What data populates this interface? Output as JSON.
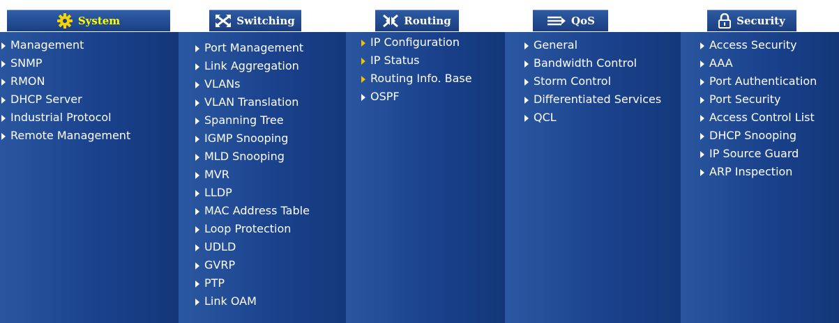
{
  "colors": {
    "tab_text": "#ffffff",
    "active_tab_text": "#ffff00",
    "item_text": "#ffffff",
    "routing_arrow": "#f5c000"
  },
  "tabs": [
    {
      "key": "system",
      "label": "System",
      "icon": "gear-icon",
      "active": true
    },
    {
      "key": "switching",
      "label": "Switching",
      "icon": "crossed-arrows-icon",
      "active": false
    },
    {
      "key": "routing",
      "label": "Routing",
      "icon": "converging-arrows-icon",
      "active": false
    },
    {
      "key": "qos",
      "label": "QoS",
      "icon": "lanes-arrow-icon",
      "active": false
    },
    {
      "key": "security",
      "label": "Security",
      "icon": "padlock-icon",
      "active": false
    }
  ],
  "columns": {
    "system": [
      "Management",
      "SNMP",
      "RMON",
      "DHCP Server",
      "Industrial Protocol",
      "Remote Management"
    ],
    "switching": [
      "Port Management",
      "Link Aggregation",
      "VLANs",
      "VLAN Translation",
      "Spanning Tree",
      "IGMP Snooping",
      "MLD Snooping",
      "MVR",
      "LLDP",
      "MAC Address Table",
      "Loop Protection",
      "UDLD",
      "GVRP",
      "PTP",
      "Link OAM"
    ],
    "routing": [
      "IP Configuration",
      "IP Status",
      "Routing Info. Base",
      "OSPF"
    ],
    "qos": [
      "General",
      "Bandwidth Control",
      "Storm Control",
      "Differentiated Services",
      "QCL"
    ],
    "security": [
      "Access Security",
      "AAA",
      "Port Authentication",
      "Port Security",
      "Access Control List",
      "DHCP Snooping",
      "IP Source Guard",
      "ARP Inspection"
    ]
  }
}
